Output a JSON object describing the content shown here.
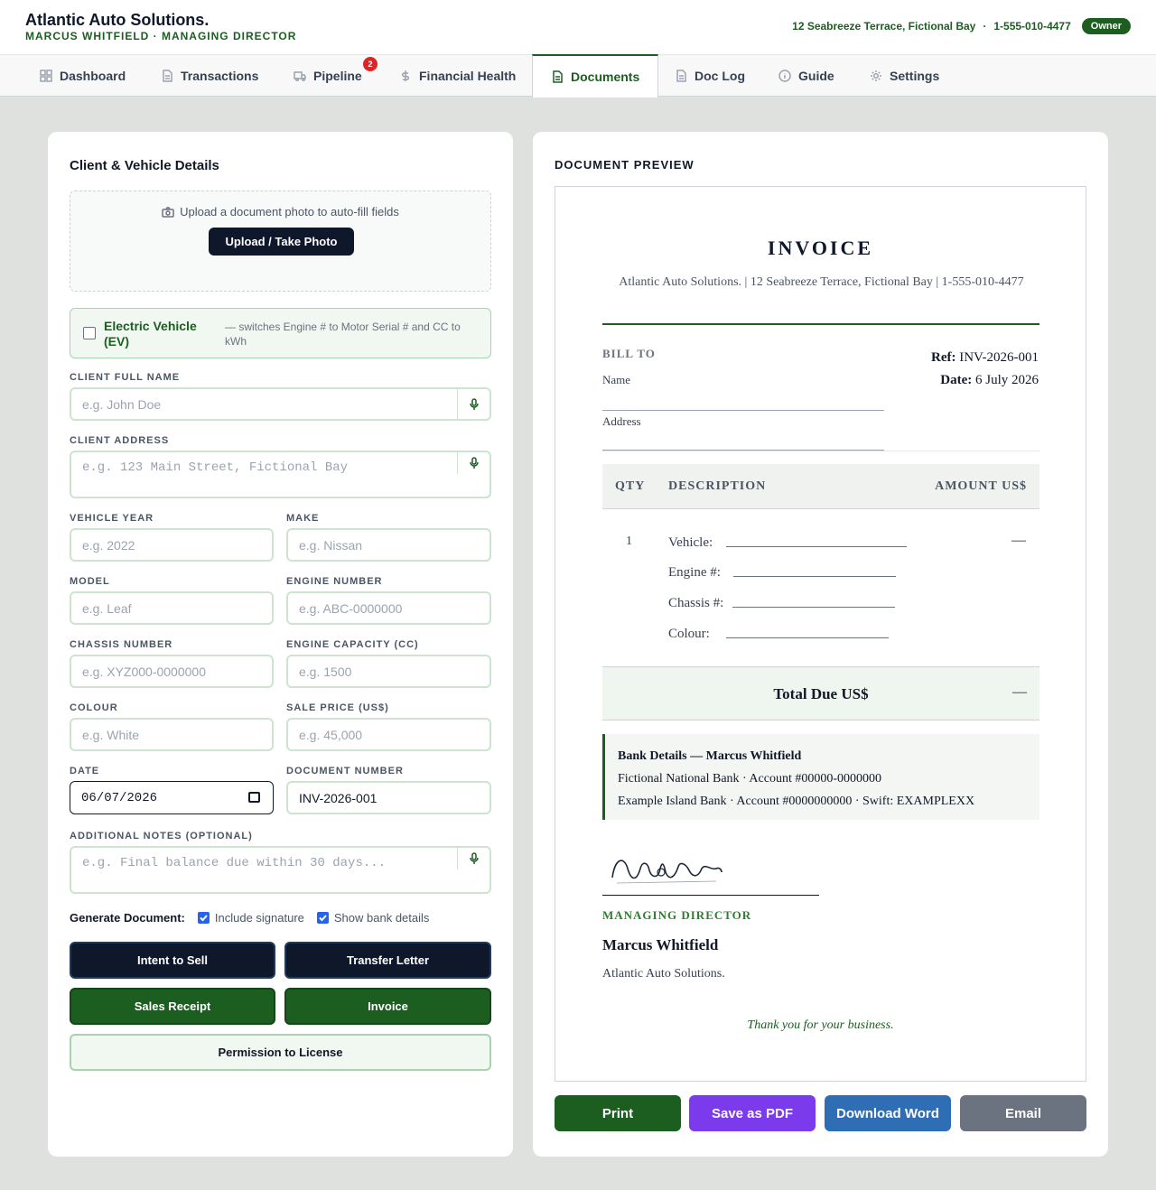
{
  "header": {
    "title": "Atlantic Auto Solutions.",
    "subtitle": "MARCUS WHITFIELD · MANAGING DIRECTOR",
    "address": "12 Seabreeze Terrace, Fictional Bay",
    "sep": "·",
    "phone": "1-555-010-4477",
    "badge": "Owner"
  },
  "tabs": [
    {
      "label": "Dashboard",
      "icon": "grid-icon"
    },
    {
      "label": "Transactions",
      "icon": "file-icon"
    },
    {
      "label": "Pipeline",
      "icon": "truck-icon",
      "badge": "2"
    },
    {
      "label": "Financial Health",
      "icon": "dollar-icon"
    },
    {
      "label": "Documents",
      "icon": "document-icon",
      "active": true
    },
    {
      "label": "Doc Log",
      "icon": "document-icon"
    },
    {
      "label": "Guide",
      "icon": "info-icon"
    },
    {
      "label": "Settings",
      "icon": "gear-icon"
    }
  ],
  "form": {
    "title": "Client & Vehicle Details",
    "upload_hint": "Upload a document photo to auto-fill fields",
    "upload_button": "Upload / Take Photo",
    "ev_label": "Electric Vehicle (EV)",
    "ev_note": "— switches Engine # to Motor Serial # and CC to kWh",
    "client_name": {
      "label": "CLIENT FULL NAME",
      "placeholder": "e.g. John Doe"
    },
    "client_address": {
      "label": "CLIENT ADDRESS",
      "placeholder": "e.g. 123 Main Street, Fictional Bay"
    },
    "vehicle_year": {
      "label": "VEHICLE YEAR",
      "placeholder": "e.g. 2022"
    },
    "make": {
      "label": "MAKE",
      "placeholder": "e.g. Nissan"
    },
    "model": {
      "label": "MODEL",
      "placeholder": "e.g. Leaf"
    },
    "engine_number": {
      "label": "ENGINE NUMBER",
      "placeholder": "e.g. ABC-0000000"
    },
    "chassis_number": {
      "label": "CHASSIS NUMBER",
      "placeholder": "e.g. XYZ000-0000000"
    },
    "engine_capacity": {
      "label": "ENGINE CAPACITY (CC)",
      "placeholder": "e.g. 1500"
    },
    "colour": {
      "label": "COLOUR",
      "placeholder": "e.g. White"
    },
    "sale_price": {
      "label": "SALE PRICE (US$)",
      "placeholder": "e.g. 45,000"
    },
    "date": {
      "label": "DATE",
      "value": "06/07/2026"
    },
    "document_number": {
      "label": "DOCUMENT NUMBER",
      "value": "INV-2026-001"
    },
    "notes": {
      "label": "ADDITIONAL NOTES (OPTIONAL)",
      "placeholder": "e.g. Final balance due within 30 days..."
    },
    "generate_label": "Generate Document:",
    "include_signature": "Include signature",
    "show_bank": "Show bank details",
    "buttons": {
      "intent": "Intent to Sell",
      "transfer": "Transfer Letter",
      "receipt": "Sales Receipt",
      "invoice": "Invoice",
      "permission": "Permission to License"
    }
  },
  "preview": {
    "title": "DOCUMENT PREVIEW",
    "doc_title": "INVOICE",
    "company_line": "Atlantic Auto Solutions. | 12 Seabreeze Terrace, Fictional Bay | 1-555-010-4477",
    "bill_to": "BILL TO",
    "name_label": "Name",
    "address_label": "Address",
    "ref_label": "Ref:",
    "ref_value": "INV-2026-001",
    "date_label": "Date:",
    "date_value": "6 July 2026",
    "col_qty": "QTY",
    "col_desc": "DESCRIPTION",
    "col_amount": "AMOUNT US$",
    "qty": "1",
    "vehicle_label": "Vehicle:",
    "engine_label": "Engine #:",
    "chassis_label": "Chassis #:",
    "colour_label": "Colour:",
    "amount": "—",
    "total_label": "Total Due US$",
    "total_value": "—",
    "bank_heading": "Bank Details — Marcus Whitfield",
    "bank_line1": "Fictional National Bank · Account #00000-0000000",
    "bank_line2": "Example Island Bank · Account #0000000000 · Swift: EXAMPLEXX",
    "sig_role": "MANAGING DIRECTOR",
    "sig_name": "Marcus Whitfield",
    "sig_company": "Atlantic Auto Solutions.",
    "thanks": "Thank you for your business."
  },
  "actions": {
    "print": "Print",
    "pdf": "Save as PDF",
    "word": "Download Word",
    "email": "Email"
  },
  "colors": {
    "brand_green": "#1b5e20",
    "navy": "#0f172a",
    "pdf_purple": "#7c3aed",
    "word_blue": "#2f6db5",
    "email_gray": "#6b7280"
  }
}
